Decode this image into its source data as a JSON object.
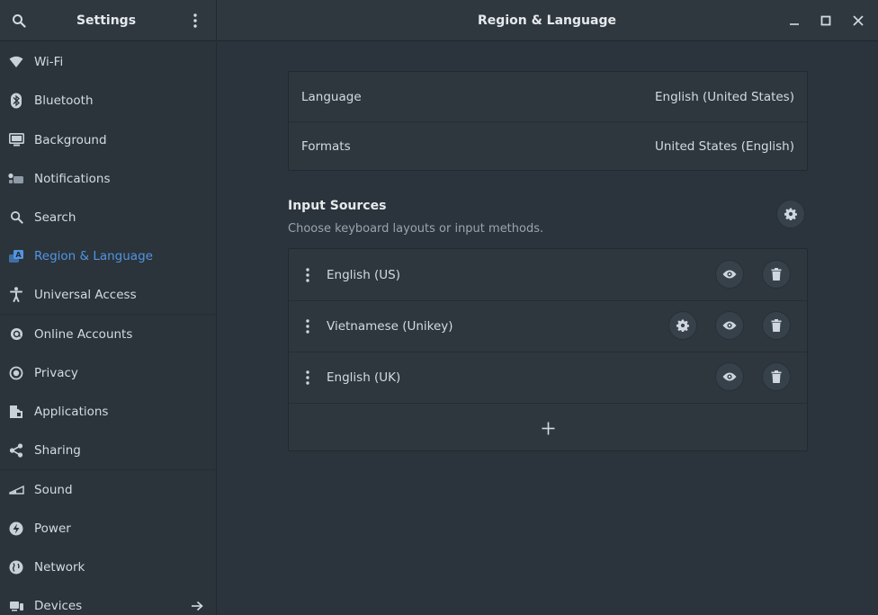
{
  "header": {
    "app_title": "Settings",
    "page_title": "Region & Language"
  },
  "sidebar": {
    "items": [
      {
        "label": "Wi-Fi",
        "icon": "wifi-icon"
      },
      {
        "label": "Bluetooth",
        "icon": "bluetooth-icon"
      },
      {
        "label": "Background",
        "icon": "display-icon"
      },
      {
        "label": "Notifications",
        "icon": "notifications-icon"
      },
      {
        "label": "Search",
        "icon": "search-icon"
      },
      {
        "label": "Region & Language",
        "icon": "region-language-icon",
        "active": true
      },
      {
        "label": "Universal Access",
        "icon": "universal-access-icon"
      },
      {
        "label": "Online Accounts",
        "icon": "online-accounts-icon"
      },
      {
        "label": "Privacy",
        "icon": "privacy-icon"
      },
      {
        "label": "Applications",
        "icon": "applications-icon"
      },
      {
        "label": "Sharing",
        "icon": "share-icon"
      },
      {
        "label": "Sound",
        "icon": "sound-icon"
      },
      {
        "label": "Power",
        "icon": "power-icon"
      },
      {
        "label": "Network",
        "icon": "network-icon"
      },
      {
        "label": "Devices",
        "icon": "devices-icon"
      }
    ]
  },
  "region": {
    "rows": [
      {
        "label": "Language",
        "value": "English (United States)"
      },
      {
        "label": "Formats",
        "value": "United States (English)"
      }
    ]
  },
  "input_sources": {
    "title": "Input Sources",
    "subtitle": "Choose keyboard layouts or input methods.",
    "sources": [
      {
        "label": "English (US)",
        "has_settings": false
      },
      {
        "label": "Vietnamese (Unikey)",
        "has_settings": true
      },
      {
        "label": "English (UK)",
        "has_settings": false
      }
    ],
    "add_symbol": "+"
  },
  "colors": {
    "accent": "#5294e2",
    "background": "#2b343c",
    "card": "#2e373e"
  }
}
